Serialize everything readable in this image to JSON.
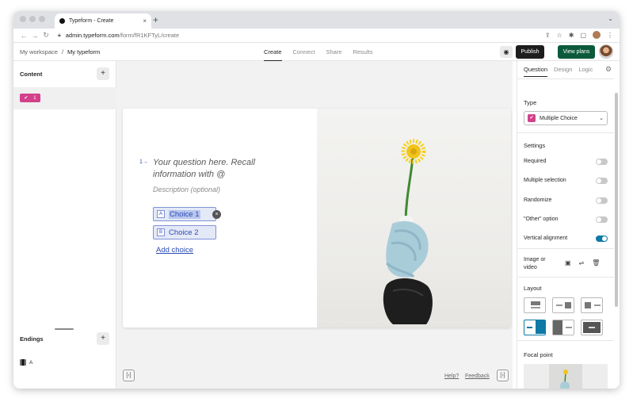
{
  "browser": {
    "tab_title": "Typeform - Create",
    "tab_close": "×",
    "new_tab": "+",
    "url_domain": "admin.typeform.com",
    "url_path": "/form/fR1KFTyL/create"
  },
  "header": {
    "workspace": "My workspace",
    "separator": "/",
    "form_name": "My typeform",
    "tabs": [
      "Create",
      "Connect",
      "Share",
      "Results"
    ],
    "active_tab": "Create",
    "publish_label": "Publish",
    "view_plans_label": "View plans"
  },
  "left": {
    "content_title": "Content",
    "question_number": "1",
    "endings_title": "Endings",
    "ending_label": "A"
  },
  "question": {
    "number": "1→",
    "text": "Your question here. Recall information with @",
    "description": "Description (optional)",
    "choices": [
      {
        "key": "A",
        "label": "Choice 1"
      },
      {
        "key": "B",
        "label": "Choice 2"
      }
    ],
    "add_choice": "Add choice"
  },
  "footer": {
    "help": "Help?",
    "feedback": "Feedback"
  },
  "right": {
    "tabs": [
      "Question",
      "Design",
      "Logic"
    ],
    "active_tab": "Question",
    "type_heading": "Type",
    "type_value": "Multiple Choice",
    "settings_heading": "Settings",
    "settings": [
      {
        "label": "Required",
        "on": false
      },
      {
        "label": "Multiple selection",
        "on": false
      },
      {
        "label": "Randomize",
        "on": false
      },
      {
        "label": "\"Other\" option",
        "on": false
      },
      {
        "label": "Vertical alignment",
        "on": true
      }
    ],
    "media_label": "Image or video",
    "layout_heading": "Layout",
    "focal_heading": "Focal point"
  },
  "colors": {
    "accent_pink": "#d2418a",
    "link_blue": "#2c4bb5",
    "publish_dark": "#1d1d1d",
    "plans_green": "#0b5a3b",
    "toggle_on": "#0d7aa6"
  }
}
